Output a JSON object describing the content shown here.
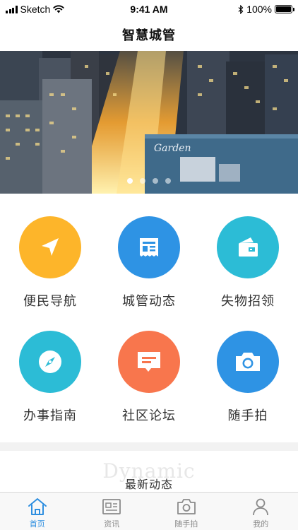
{
  "status_bar": {
    "carrier": "Sketch",
    "time": "9:41 AM",
    "battery": "100%"
  },
  "nav": {
    "title": "智慧城管"
  },
  "banner": {
    "sign_text": "Garden",
    "dots": 4,
    "active_dot": 0
  },
  "grid": {
    "items": [
      {
        "label": "便民导航",
        "icon": "navigation-arrow-icon",
        "color": "#FDB52A"
      },
      {
        "label": "城管动态",
        "icon": "newspaper-icon",
        "color": "#2E93E4"
      },
      {
        "label": "失物招领",
        "icon": "wallet-icon",
        "color": "#2CBCD6"
      },
      {
        "label": "办事指南",
        "icon": "compass-icon",
        "color": "#2CBCD6"
      },
      {
        "label": "社区论坛",
        "icon": "message-icon",
        "color": "#F8764D"
      },
      {
        "label": "随手拍",
        "icon": "camera-icon",
        "color": "#2E93E4"
      }
    ]
  },
  "news": {
    "bg_text": "Dynamic",
    "title": "最新动态"
  },
  "tabs": [
    {
      "label": "首页",
      "icon": "home-icon",
      "active": true
    },
    {
      "label": "资讯",
      "icon": "news-icon",
      "active": false
    },
    {
      "label": "随手拍",
      "icon": "camera-icon",
      "active": false
    },
    {
      "label": "我的",
      "icon": "user-icon",
      "active": false
    }
  ],
  "colors": {
    "accent": "#2F8FE0",
    "tab_inactive": "#8A8A8A"
  }
}
